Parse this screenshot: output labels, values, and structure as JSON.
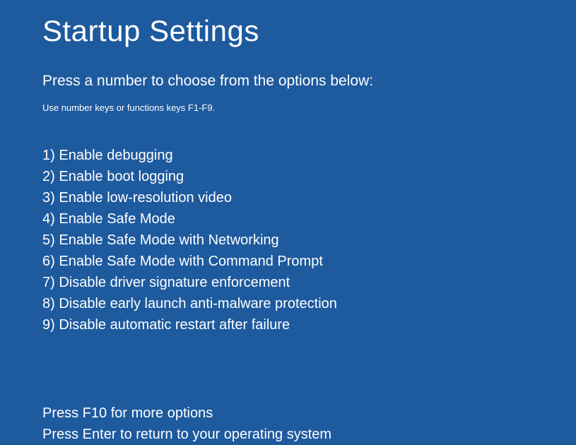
{
  "title": "Startup Settings",
  "subtitle": "Press a number to choose from the options below:",
  "instruction": "Use number keys or functions keys F1-F9.",
  "options": [
    {
      "number": "1)",
      "label": "Enable debugging"
    },
    {
      "number": "2)",
      "label": "Enable boot logging"
    },
    {
      "number": "3)",
      "label": "Enable low-resolution video"
    },
    {
      "number": "4)",
      "label": "Enable Safe Mode"
    },
    {
      "number": "5)",
      "label": "Enable Safe Mode with Networking"
    },
    {
      "number": "6)",
      "label": "Enable Safe Mode with Command Prompt"
    },
    {
      "number": "7)",
      "label": "Disable driver signature enforcement"
    },
    {
      "number": "8)",
      "label": "Disable early launch anti-malware protection"
    },
    {
      "number": "9)",
      "label": "Disable automatic restart after failure"
    }
  ],
  "footer": {
    "more_options": "Press F10 for more options",
    "return": "Press Enter to return to your operating system"
  }
}
